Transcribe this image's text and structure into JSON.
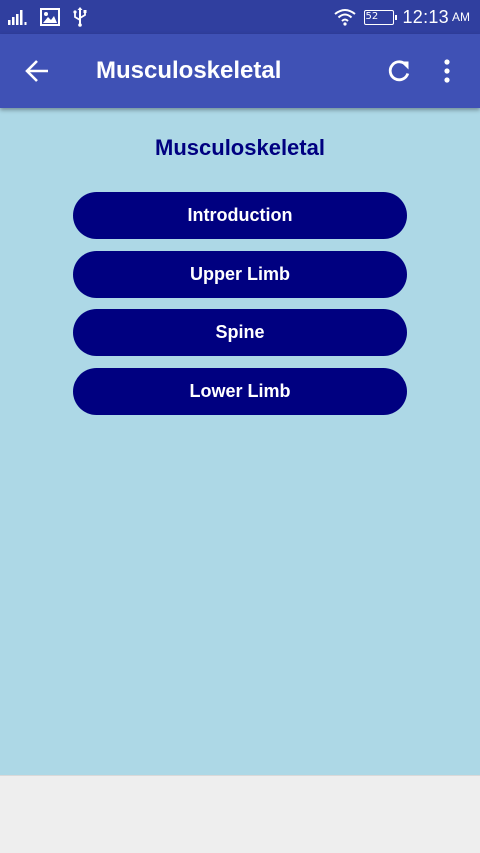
{
  "status_bar": {
    "time": "12:13",
    "ampm": "AM",
    "battery": "52",
    "icons": [
      "signal-icon",
      "image-icon",
      "usb-icon",
      "wifi-icon",
      "battery-icon"
    ]
  },
  "app_bar": {
    "title": "Musculoskeletal",
    "icons": [
      "back-arrow-icon",
      "refresh-icon",
      "more-vert-icon"
    ]
  },
  "main": {
    "heading": "Musculoskeletal",
    "buttons": [
      {
        "label": "Introduction"
      },
      {
        "label": "Upper Limb"
      },
      {
        "label": "Spine"
      },
      {
        "label": "Lower Limb"
      }
    ]
  },
  "colors": {
    "status_bar": "#303f9f",
    "app_bar": "#3f51b5",
    "content_background": "#add8e6",
    "button": "#000080",
    "heading": "#000080"
  }
}
